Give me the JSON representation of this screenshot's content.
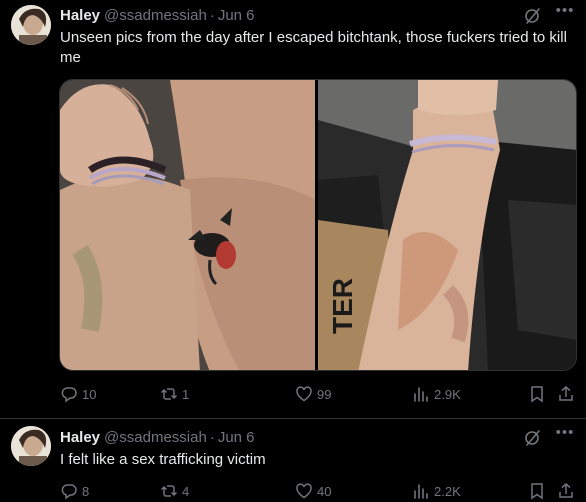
{
  "tweets": [
    {
      "author_name": "Haley",
      "handle": "@ssadmessiah",
      "separator": "·",
      "date": "Jun 6",
      "text": "Unseen pics from the day after I escaped bitchtank, those fuckers tried to kill me",
      "metrics": {
        "replies": "10",
        "retweets": "1",
        "likes": "99",
        "views": "2.9K"
      },
      "photos": [
        {
          "description_icon": "photo-arm-tattoo"
        },
        {
          "description_icon": "photo-arm-bruise",
          "box_text": "TER"
        }
      ]
    },
    {
      "author_name": "Haley",
      "handle": "@ssadmessiah",
      "separator": "·",
      "date": "Jun 6",
      "text": "I felt like a sex trafficking victim",
      "metrics": {
        "replies": "8",
        "retweets": "4",
        "likes": "40",
        "views": "2.2K"
      }
    }
  ],
  "icons": {
    "more": "more-icon",
    "grok": "grok-icon",
    "reply": "reply-icon",
    "retweet": "retweet-icon",
    "like": "like-icon",
    "views": "views-icon",
    "bookmark": "bookmark-icon",
    "share": "share-icon"
  },
  "colors": {
    "background": "#000000",
    "text": "#e7e9ea",
    "muted": "#71767b",
    "border": "#2f3336"
  }
}
